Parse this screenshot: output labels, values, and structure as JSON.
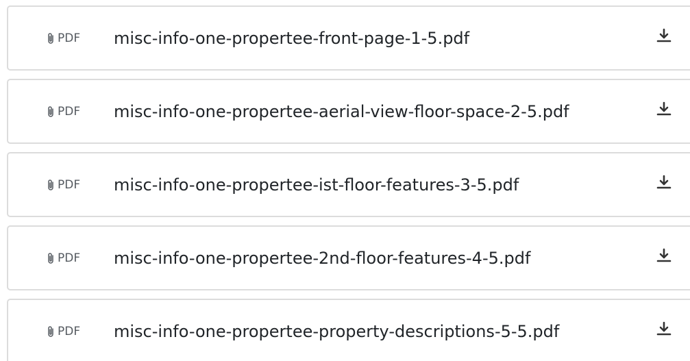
{
  "files": [
    {
      "type": "PDF",
      "name": "misc-info-one-propertee-front-page-1-5.pdf",
      "icon": "paperclip-icon",
      "action_icon": "download-icon"
    },
    {
      "type": "PDF",
      "name": "misc-info-one-propertee-aerial-view-floor-space-2-5.pdf",
      "icon": "paperclip-icon",
      "action_icon": "download-icon"
    },
    {
      "type": "PDF",
      "name": "misc-info-one-propertee-ist-floor-features-3-5.pdf",
      "icon": "paperclip-icon",
      "action_icon": "download-icon"
    },
    {
      "type": "PDF",
      "name": "misc-info-one-propertee-2nd-floor-features-4-5.pdf",
      "icon": "paperclip-icon",
      "action_icon": "download-icon"
    },
    {
      "type": "PDF",
      "name": "misc-info-one-propertee-property-descriptions-5-5.pdf",
      "icon": "paperclip-icon",
      "action_icon": "download-icon"
    }
  ],
  "colors": {
    "border": "#dcdcdc",
    "text": "#212529",
    "muted": "#555a60",
    "icon": "#333333"
  }
}
